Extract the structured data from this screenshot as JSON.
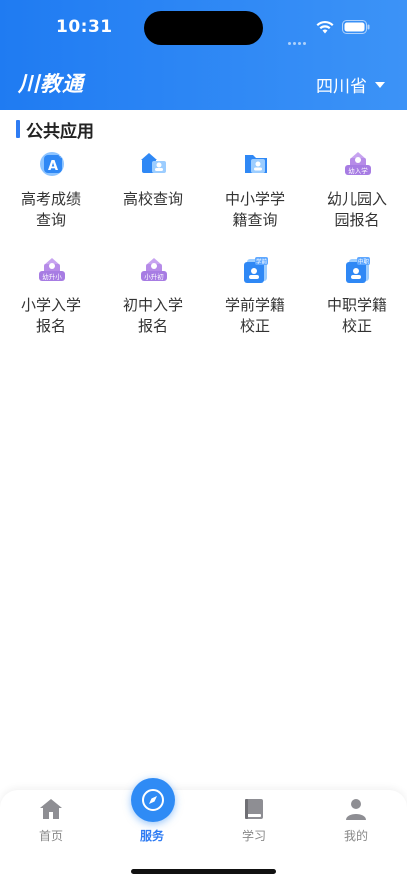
{
  "status": {
    "time": "10:31"
  },
  "header": {
    "logo": "川教通",
    "province": "四川省"
  },
  "section": {
    "title": "公共应用"
  },
  "apps": [
    {
      "label": "高考成绩\n查询",
      "icon": "gaokao-score-icon"
    },
    {
      "label": "高校查询",
      "icon": "university-icon"
    },
    {
      "label": "中小学学\n籍查询",
      "icon": "school-roll-icon"
    },
    {
      "label": "幼儿园入\n园报名",
      "icon": "kindergarten-icon"
    },
    {
      "label": "小学入学\n报名",
      "icon": "primary-enroll-icon"
    },
    {
      "label": "初中入学\n报名",
      "icon": "middle-enroll-icon"
    },
    {
      "label": "学前学籍\n校正",
      "icon": "preschool-roll-icon"
    },
    {
      "label": "中职学籍\n校正",
      "icon": "vocational-roll-icon"
    }
  ],
  "icon_badges": {
    "kindergarten": "幼入学",
    "primary": "幼升小",
    "middle": "小升初",
    "preschool": "学前",
    "vocational": "中职"
  },
  "tabs": [
    {
      "label": "首页",
      "icon": "home-icon"
    },
    {
      "label": "服务",
      "icon": "compass-icon"
    },
    {
      "label": "学习",
      "icon": "book-icon"
    },
    {
      "label": "我的",
      "icon": "person-icon"
    }
  ],
  "colors": {
    "accent": "#2f7cf3",
    "header_start": "#1f7bf2",
    "header_end": "#3c93f7"
  }
}
